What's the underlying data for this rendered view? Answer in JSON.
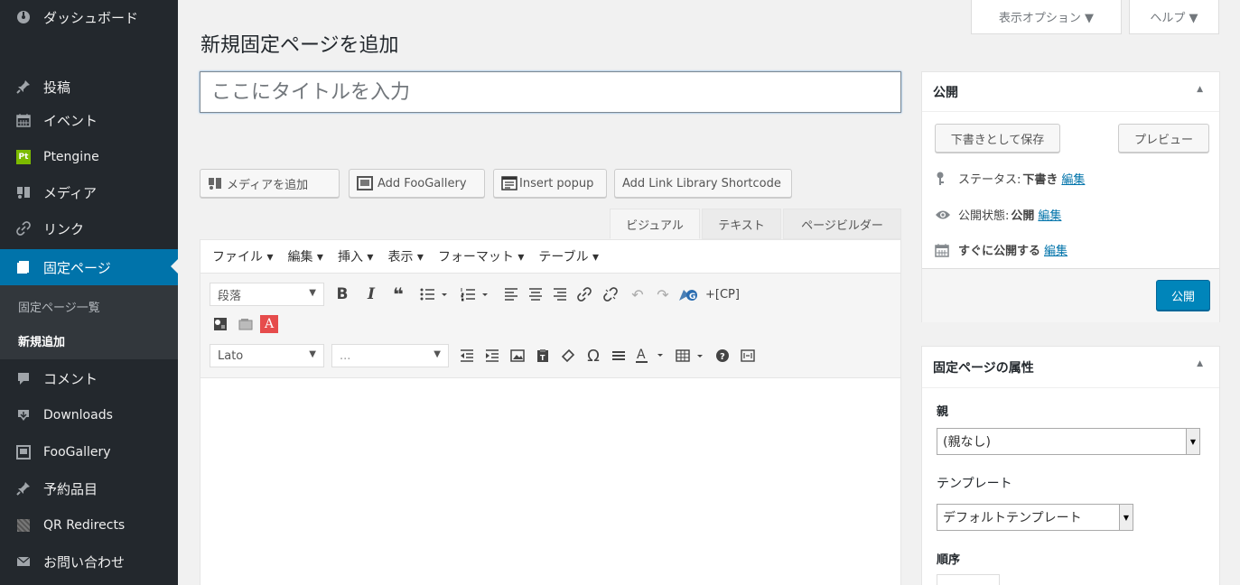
{
  "sidebar": {
    "items": [
      {
        "label": "ダッシュボード",
        "icon": "dashboard-icon"
      },
      {
        "label": "投稿",
        "icon": "pin-icon"
      },
      {
        "label": "イベント",
        "icon": "calendar-icon"
      },
      {
        "label": "Ptengine",
        "icon": "ptengine-logo",
        "icon_text": "Pt"
      },
      {
        "label": "メディア",
        "icon": "media-icon"
      },
      {
        "label": "リンク",
        "icon": "link-icon"
      },
      {
        "label": "固定ページ",
        "icon": "page-icon"
      },
      {
        "label": "コメント",
        "icon": "comment-icon"
      },
      {
        "label": "Downloads",
        "icon": "download-icon"
      },
      {
        "label": "FooGallery",
        "icon": "gallery-icon"
      },
      {
        "label": "予約品目",
        "icon": "pin-icon"
      },
      {
        "label": "QR Redirects",
        "icon": "qr-icon"
      },
      {
        "label": "お問い合わせ",
        "icon": "mail-icon"
      }
    ],
    "submenu": [
      {
        "label": "固定ページ一覧"
      },
      {
        "label": "新規追加"
      }
    ]
  },
  "screen_tabs": {
    "options": "表示オプション ▼",
    "help": "ヘルプ ▼"
  },
  "page_title": "新規固定ページを追加",
  "title_input": {
    "placeholder": "ここにタイトルを入力",
    "value": ""
  },
  "media_buttons": [
    {
      "label": "メディアを追加",
      "icon": "media-icon"
    },
    {
      "label": "Add FooGallery",
      "icon": "gallery-icon"
    },
    {
      "label": "Insert popup",
      "icon": "popup-icon"
    },
    {
      "label": "Add Link Library Shortcode",
      "icon": ""
    }
  ],
  "editor_tabs": [
    {
      "label": "ビジュアル",
      "active": true
    },
    {
      "label": "テキスト",
      "active": false
    },
    {
      "label": "ページビルダー",
      "active": false
    }
  ],
  "menubar": [
    "ファイル ▾",
    "編集 ▾",
    "挿入 ▾",
    "表示 ▾",
    "フォーマット ▾",
    "テーブル ▾"
  ],
  "toolbar": {
    "format_select": "段落",
    "font_select": "Lato",
    "size_select": "...",
    "shortcode_label": "+[CP]",
    "row1_icons": [
      "bold-icon",
      "italic-icon",
      "blockquote-icon",
      "bullet-list-icon",
      "numbered-list-icon",
      "align-left-icon",
      "align-center-icon",
      "align-right-icon",
      "link-icon",
      "unlink-icon",
      "undo-icon",
      "redo-icon",
      "g-plugin-icon"
    ],
    "row2_icons": [
      "puzzle-icon",
      "card-icon",
      "acrobat-icon"
    ],
    "row3_icons": [
      "outdent-icon",
      "indent-icon",
      "image-icon",
      "paste-text-icon",
      "clear-format-icon",
      "omega-icon",
      "hr-icon",
      "text-color-icon",
      "table-icon",
      "help-icon",
      "fullscreen-icon"
    ]
  },
  "publish_box": {
    "title": "公開",
    "save_draft": "下書きとして保存",
    "preview": "プレビュー",
    "status_label": "ステータス:",
    "status_value": "下書き",
    "visibility_label": "公開状態:",
    "visibility_value": "公開",
    "schedule_label": "すぐに公開する",
    "edit_link": "編集",
    "publish_button": "公開"
  },
  "page_attributes": {
    "title": "固定ページの属性",
    "parent_label": "親",
    "parent_value": "(親なし)",
    "template_label": "テンプレート",
    "template_value": "デフォルトテンプレート",
    "order_label": "順序"
  },
  "colors": {
    "sidebar_bg": "#23282d",
    "accent": "#0073aa",
    "publish_button": "#0085ba"
  }
}
